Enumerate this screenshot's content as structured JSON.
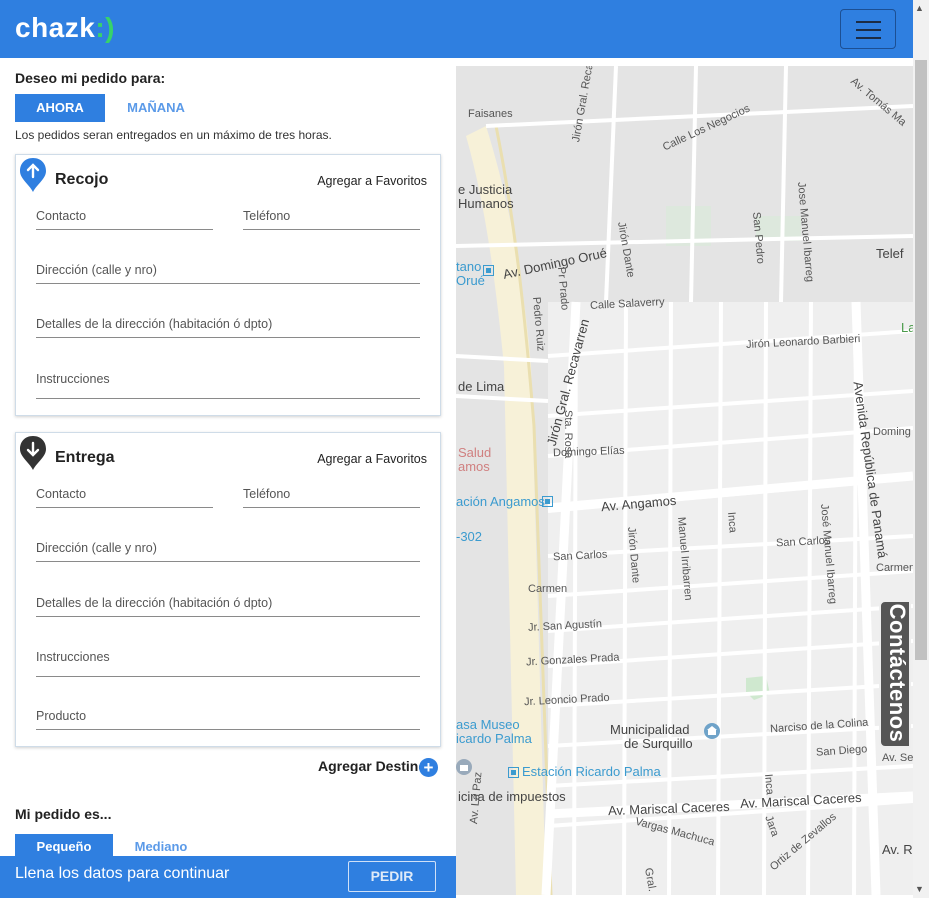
{
  "header": {
    "brand": "chazk",
    "brand_mark": ":)",
    "menu_icon": "hamburger-icon"
  },
  "schedule": {
    "title": "Deseo mi pedido para:",
    "tab_now": "AHORA",
    "tab_tomorrow": "MAÑANA",
    "note": "Los pedidos seran entregados en un máximo de tres horas."
  },
  "pickup": {
    "title": "Recojo",
    "favorites": "Agregar a Favoritos",
    "contact": "Contacto",
    "phone": "Teléfono",
    "address": "Dirección (calle y nro)",
    "details": "Detalles de la dirección (habitación ó dpto)",
    "instructions": "Instrucciones",
    "color": "#2f7fe0"
  },
  "delivery": {
    "title": "Entrega",
    "favorites": "Agregar a Favoritos",
    "contact": "Contacto",
    "phone": "Teléfono",
    "address": "Dirección (calle y nro)",
    "details": "Detalles de la dirección (habitación ó dpto)",
    "instructions": "Instrucciones",
    "product": "Producto",
    "color": "#333333"
  },
  "add_destination": "Agregar Destino",
  "size": {
    "title": "Mi pedido es...",
    "small": "Pequeño",
    "medium": "Mediano"
  },
  "footer": {
    "message": "Llena los datos para continuar",
    "submit": "PEDIR"
  },
  "map": {
    "labels": {
      "faisanes": "Faisanes",
      "negocios": "Calle Los Negocios",
      "tomas": "Av. Tomás Ma",
      "justicia1": "e Justicia",
      "justicia2": "Humanos",
      "recavarren_top": "Jirón Gral. Recavarren",
      "dante_top": "Jirón Dante",
      "manuel_ib": "Jose Manuel Ibarreg",
      "san_pedro": "San Pedro",
      "domingo_orue": "Av. Domingo Orué",
      "stano1": "tano",
      "stano2": "Orué",
      "telef": "Telef",
      "prado": "Pr Prado",
      "pedro_ruiz": "Pedro Ruiz",
      "salaverry": "Calle Salaverry",
      "leonardo": "Jirón Leonardo Barbieri",
      "la": "La",
      "recavarren": "Jirón Gral. Recavarren",
      "de_lima": "de Lima",
      "sta_rosa": "Sta. Rosa",
      "avenida_rep": "Avenida República de Panamá",
      "domingo": "Doming",
      "salud1": "Salud",
      "salud2": "amos",
      "domingo_elias": "Domingo Elías",
      "estacion_ang": "ación Angamos",
      "angamos": "Av. Angamos",
      "j302": "-302",
      "jdante": "Jirón Dante",
      "manuel": "Manuel Irribarren",
      "inca": "Inca",
      "jose_manuel": "José Manuel Ibarreg",
      "san_carlos1": "San Carlos",
      "san_carlos2": "San Carlos",
      "carmen1": "Carmen",
      "carmen2": "Carmen",
      "sagustin": "Jr. San Agustín",
      "gonzales": "Jr. Gonzales Prada",
      "leoncio": "Jr. Leoncio Prado",
      "museo1": "asa Museo",
      "museo2": "icardo Palma",
      "municipalidad1": "Municipalidad",
      "municipalidad2": "de Surquillo",
      "narciso": "Narciso de la Colina",
      "san_diego": "San Diego",
      "av_ser": "Av. Ser",
      "estacion_rp": "Estación Ricardo Palma",
      "impuestos": "icina de impuestos",
      "mariscal1": "Av. Mariscal Caceres",
      "mariscal2": "Av. Mariscal Caceres",
      "vargas": "Vargas Machuca",
      "ortiz": "Ortiz de Zevallos",
      "jara": "Jara",
      "inca2": "Inca",
      "av_paz": "Av. La Paz",
      "gral": "Gral.",
      "av_ro": "Av. Ro"
    }
  },
  "contact_tab": "Contáctenos"
}
